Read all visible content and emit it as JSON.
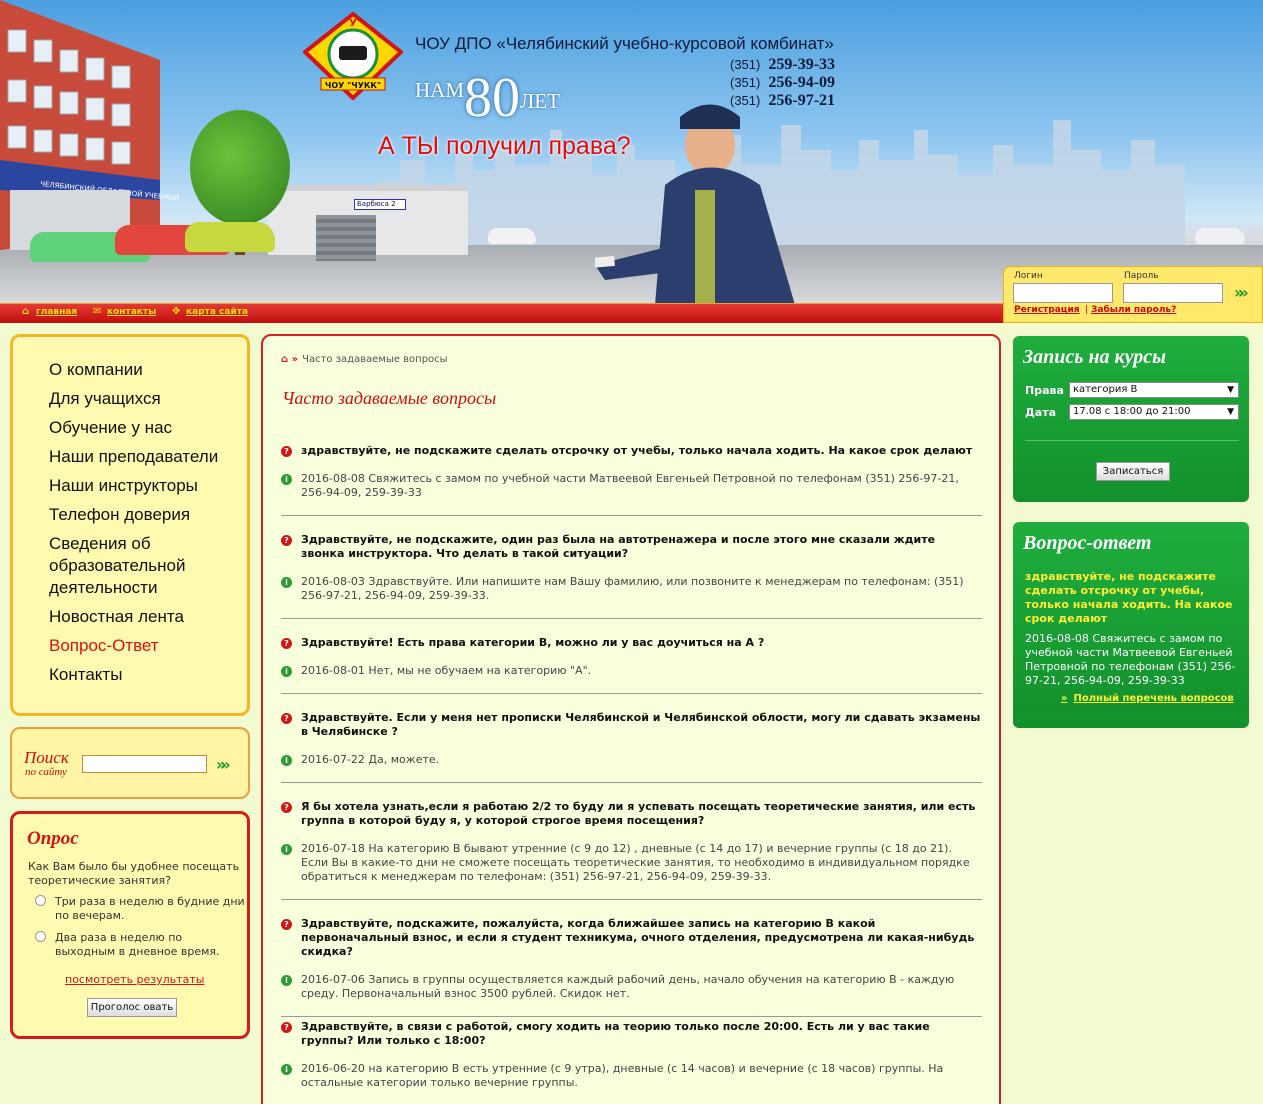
{
  "header": {
    "site_name": "ЧОУ ДПО «Челябинский учебно-курсовой комбинат»",
    "logo_text": "ЧОУ \"ЧУКК\"",
    "logo_letter": "У",
    "years_prefix": "НАМ",
    "years_number": "80",
    "years_suffix": "ЛЕТ",
    "slogan": "А ТЫ получил права?",
    "building_sign": "ЧЕЛЯБИНСКИЙ ОБЛАСТНОЙ УЧЕБНЫЙ",
    "street_sign": "Барбюса 2",
    "phones": [
      {
        "code": "(351)",
        "number": "259-39-33"
      },
      {
        "code": "(351)",
        "number": "256-94-09"
      },
      {
        "code": "(351)",
        "number": "256-97-21"
      }
    ]
  },
  "topnav": {
    "home": "главная",
    "contacts": "контакты",
    "sitemap": "карта сайта"
  },
  "login": {
    "login_label": "Логин",
    "password_label": "Пароль",
    "register": "Регистрация",
    "separator": "|",
    "forgot": "Забыли пароль?"
  },
  "menu": {
    "items": [
      {
        "label": "О компании"
      },
      {
        "label": "Для учащихся"
      },
      {
        "label": "Обучение у нас"
      },
      {
        "label": "Наши преподаватели"
      },
      {
        "label": "Наши инструкторы"
      },
      {
        "label": "Телефон доверия"
      },
      {
        "label": "Сведения об образовательной деятельности"
      },
      {
        "label": "Новостная лента"
      },
      {
        "label": "Вопрос-Ответ"
      },
      {
        "label": "Контакты"
      }
    ],
    "active": "Вопрос-Ответ"
  },
  "search": {
    "title": "Поиск",
    "subtitle": "по сайту"
  },
  "poll": {
    "title": "Опрос",
    "question": "Как Вам было бы удобнее посещать теоретические занятия?",
    "options": [
      "Три раза в неделю в будние дни по вечерам.",
      "Два раза в неделю по выходным в дневное время."
    ],
    "results_link": "посмотреть результаты",
    "vote_button": "Проголос овать"
  },
  "main": {
    "breadcrumb": "Часто задаваемые вопросы",
    "title": "Часто задаваемые вопросы",
    "items": [
      {
        "q": "здравствуйте, не подскажите сделать отсрочку от учебы, только начала ходить. На какое срок делают",
        "a": "2016-08-08 Свяжитесь с замом по учебной части Матвеевой Евгеньей Петровной по телефонам (351) 256-97-21, 256-94-09, 259-39-33"
      },
      {
        "q": "Здравствуйте, не подскажите, один раз была на автотренажера и после этого мне сказали ждите звонка инструктора. Что делать в такой ситуации?",
        "a": "2016-08-03 Здравствуйте. Или напишите нам Вашу фамилию, или позвоните к менеджерам по телефонам: (351) 256-97-21, 256-94-09, 259-39-33."
      },
      {
        "q": "Здравствуйте! Есть права категории В, можно ли у вас доучиться на А ?",
        "a": "2016-08-01 Нет, мы не обучаем на категорию \"А\"."
      },
      {
        "q": "Здравствуйте. Если у меня нет прописки Челябинской и Челябинской облости, могу ли сдавать экзамены в Челябинске ?",
        "a": "2016-07-22 Да, можете."
      },
      {
        "q": "Я бы хотела узнать,если я работаю 2/2 то буду ли я успевать посещать теоретические занятия, или есть группа в которой буду я, у которой строгое время посещения?",
        "a": "2016-07-18 На категорию В бывают утренние (с 9 до 12) , дневные (с 14 до 17) и вечерние группы (с 18 до 21). Если Вы в какие-то дни не сможете посещать теоретические занятия, то необходимо в индивидуальном порядке обратиться к менеджерам по телефонам: (351) 256-97-21, 256-94-09, 259-39-33."
      },
      {
        "q": "Здравствуйте, подскажите, пожалуйста, когда ближайшее запись на категорию В какой первоначальный взнос, и если я студент техникума, очного отделения, предусмотрена ли какая-нибудь скидка?",
        "a": "2016-07-06 Запись в группы осуществляется каждый рабочий день, начало обучения на категорию В - каждую среду. Первоначальный взнос 3500 рублей. Скидок нет."
      },
      {
        "q": "Здравствуйте, в связи с работой, смогу ходить на теорию только после 20:00. Есть ли у вас такие группы? Или только с 18:00?",
        "a": "2016-06-20 на категорию В есть утренние (с 9 утра), дневные (с 14 часов) и вечерние (с 18 часов) группы. На остальные категории только вечерние группы."
      }
    ]
  },
  "enroll": {
    "title": "Запись на курсы",
    "rights_label": "Права",
    "rights_value": "категория B",
    "date_label": "Дата",
    "date_value": "17.08 с 18:00 до 21:00",
    "button": "Записаться"
  },
  "faq": {
    "title": "Вопрос-ответ",
    "question": "здравствуйте, не подскажите сделать отсрочку от учебы, только начала ходить. На какое срок делают",
    "answer": "2016-08-08 Свяжитесь с замом по учебной части Матвеевой Евгеньей Петровной по телефонам (351) 256-97-21, 256-94-09, 259-39-33",
    "more": "Полный перечень вопросов"
  }
}
